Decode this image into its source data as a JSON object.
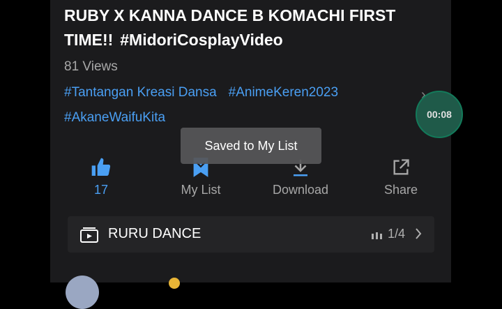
{
  "video": {
    "title_main": "RUBY X KANNA DANCE B KOMACHI FIRST TIME!!",
    "title_tag": "#MidoriCosplayVideo",
    "views": "81 Views",
    "hashtags": [
      "#Tantangan Kreasi Dansa",
      "#AnimeKeren2023",
      "#AkaneWaifuKita"
    ]
  },
  "timer": "00:08",
  "actions": {
    "like_count": "17",
    "mylist_label": "My List",
    "download_label": "Download",
    "share_label": "Share"
  },
  "toast": "Saved to My List",
  "playlist": {
    "name": "RURU DANCE",
    "count": "1/4"
  },
  "colors": {
    "accent": "#4a9ff3",
    "panel": "#1b1b1d",
    "timer_bg": "#1f5a49",
    "badge": "#e8b536"
  },
  "icons": [
    "thumbs-up-icon",
    "bookmark-icon",
    "download-icon",
    "share-icon",
    "playlist-icon",
    "chevron-right-icon",
    "bars-icon"
  ]
}
